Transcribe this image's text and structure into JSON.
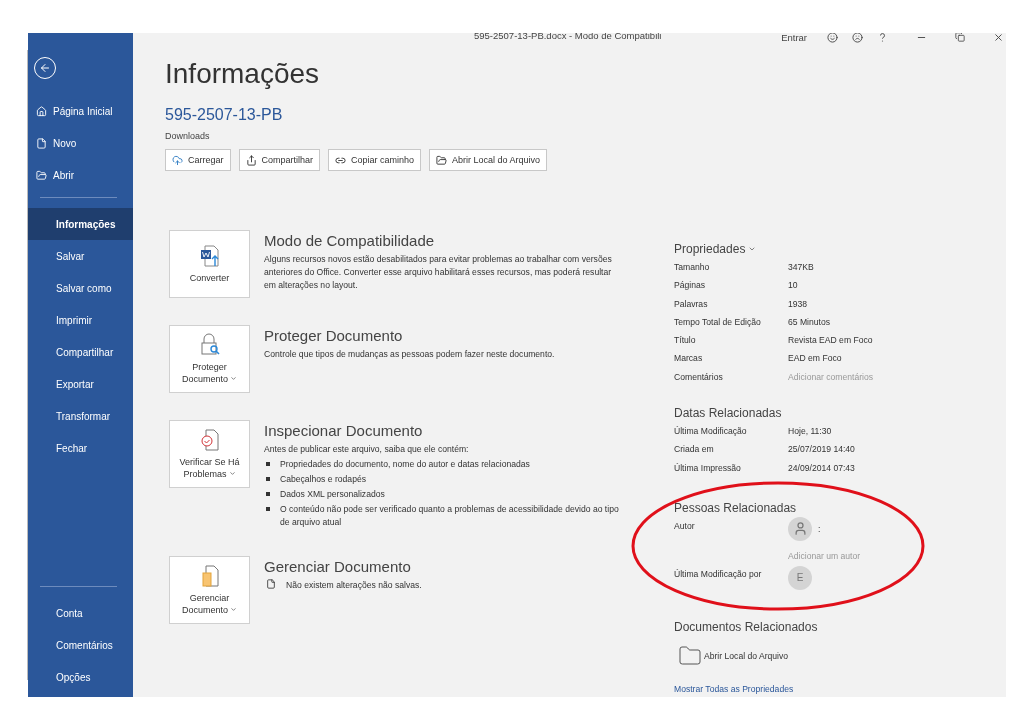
{
  "window": {
    "title": "595-2507-13-PB.docx  -  Modo de Compatibili",
    "sign_in": "Entrar"
  },
  "sidebar": {
    "top": [
      {
        "label": "Página Inicial",
        "selected": false
      },
      {
        "label": "Novo",
        "selected": false
      },
      {
        "label": "Abrir",
        "selected": false
      }
    ],
    "middle": [
      {
        "label": "Informações",
        "selected": true
      },
      {
        "label": "Salvar",
        "selected": false
      },
      {
        "label": "Salvar como",
        "selected": false
      },
      {
        "label": "Imprimir",
        "selected": false
      },
      {
        "label": "Compartilhar",
        "selected": false
      },
      {
        "label": "Exportar",
        "selected": false
      },
      {
        "label": "Transformar",
        "selected": false
      },
      {
        "label": "Fechar",
        "selected": false
      }
    ],
    "bottom": [
      {
        "label": "Conta",
        "selected": false
      },
      {
        "label": "Comentários",
        "selected": false
      },
      {
        "label": "Opções",
        "selected": false
      }
    ]
  },
  "page": {
    "title": "Informações",
    "file_name": "595-2507-13-PB",
    "location": "Downloads",
    "actions": [
      "Carregar",
      "Compartilhar",
      "Copiar caminho",
      "Abrir Local do Arquivo"
    ]
  },
  "sections": [
    {
      "tile": {
        "label": "Converter",
        "dropdown": false
      },
      "heading": "Modo de Compatibilidade",
      "text": "Alguns recursos novos estão desabilitados para evitar problemas ao trabalhar com versões anteriores do Office. Converter esse arquivo habilitará esses recursos, mas poderá resultar em alterações no layout."
    },
    {
      "tile": {
        "label": "Proteger Documento",
        "dropdown": true
      },
      "heading": "Proteger Documento",
      "text": "Controle que tipos de mudanças as pessoas podem fazer neste documento."
    },
    {
      "tile": {
        "label": "Verificar Se Há Problemas",
        "dropdown": true
      },
      "heading": "Inspecionar Documento",
      "text": "Antes de publicar este arquivo, saiba que ele contém:",
      "bullets": [
        "Propriedades do documento, nome do autor e datas relacionadas",
        "Cabeçalhos e rodapés",
        "Dados XML personalizados",
        "O conteúdo não pode ser verificado quanto a problemas de acessibilidade devido ao tipo de arquivo atual"
      ]
    },
    {
      "tile": {
        "label": "Gerenciar Documento",
        "dropdown": true
      },
      "heading": "Gerenciar Documento",
      "note": "Não existem alterações não salvas."
    }
  ],
  "properties": {
    "heading": "Propriedades",
    "rows": [
      {
        "label": "Tamanho",
        "value": "347KB",
        "muted": false
      },
      {
        "label": "Páginas",
        "value": "10",
        "muted": false
      },
      {
        "label": "Palavras",
        "value": "1938",
        "muted": false
      },
      {
        "label": "Tempo Total de Edição",
        "value": "65 Minutos",
        "muted": false
      },
      {
        "label": "Título",
        "value": "Revista EAD em Foco",
        "muted": false
      },
      {
        "label": "Marcas",
        "value": "EAD em Foco",
        "muted": false
      },
      {
        "label": "Comentários",
        "value": "Adicionar comentários",
        "muted": true
      }
    ]
  },
  "related_dates": {
    "heading": "Datas Relacionadas",
    "rows": [
      {
        "label": "Última Modificação",
        "value": "Hoje, 11:30"
      },
      {
        "label": "Criada em",
        "value": "25/07/2019 14:40"
      },
      {
        "label": "Última Impressão",
        "value": "24/09/2014 07:43"
      }
    ]
  },
  "related_people": {
    "heading": "Pessoas Relacionadas",
    "author": {
      "label": "Autor",
      "name": ":",
      "add": "Adicionar um autor"
    },
    "last_modified_by": {
      "label": "Última Modificação por",
      "initial": "E"
    }
  },
  "related_documents": {
    "heading": "Documentos Relacionados",
    "open_location": "Abrir Local do Arquivo"
  },
  "show_all": "Mostrar Todas as Propriedades"
}
